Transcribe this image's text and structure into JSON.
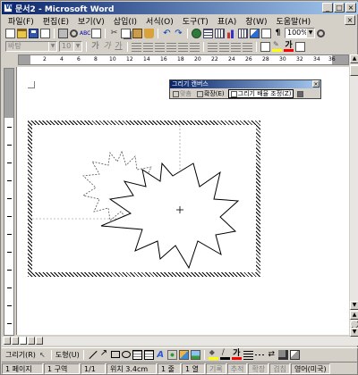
{
  "window": {
    "title": "문서2 - Microsoft Word",
    "controls": [
      "_",
      "□",
      "×"
    ]
  },
  "menubar": {
    "items": [
      "파일(F)",
      "편집(E)",
      "보기(V)",
      "삽입(I)",
      "서식(O)",
      "도구(T)",
      "표(A)",
      "창(W)",
      "도움말(H)"
    ],
    "doc_close": "×"
  },
  "toolbar_standard": {
    "zoom": "100%"
  },
  "toolbar_format": {
    "style": "바탕",
    "size": "10",
    "bold": "가",
    "italic": "가",
    "underline": "가",
    "font_color_label": "가"
  },
  "ruler": {
    "h_numbers": [
      "2",
      "4",
      "6",
      "8",
      "10",
      "12",
      "14",
      "16",
      "18",
      "20",
      "22",
      "24",
      "26",
      "28",
      "30",
      "32",
      "34",
      "36"
    ],
    "v_numbers": [
      "1",
      "2",
      "3",
      "4",
      "5",
      "6",
      "7",
      "8",
      "9",
      "10",
      "11",
      "12"
    ]
  },
  "canvas_toolbar": {
    "title": "그리기 캔버스",
    "close": "×",
    "fit_label": "맞춤",
    "expand_label": "확장(E)",
    "scale_label": "그리기 배율 조정(Z)"
  },
  "drawing_toolbar": {
    "draw_menu": "그리기(R)",
    "autoshapes_menu": "도형(U)",
    "font_color_label": "가"
  },
  "statusbar": {
    "page": "1 페이지",
    "section": "1 구역",
    "page_of": "1/1",
    "position": "위치 3.4cm",
    "line": "1 줄",
    "column": "1 열",
    "rec": "기록",
    "trk": "추적",
    "ext": "확장",
    "ovr": "겹침",
    "language": "영어(미국)"
  },
  "colors": {
    "title_start": "#0a246a",
    "title_end": "#a6caf0",
    "chrome": "#d4d0c8",
    "page": "#ffffff"
  }
}
